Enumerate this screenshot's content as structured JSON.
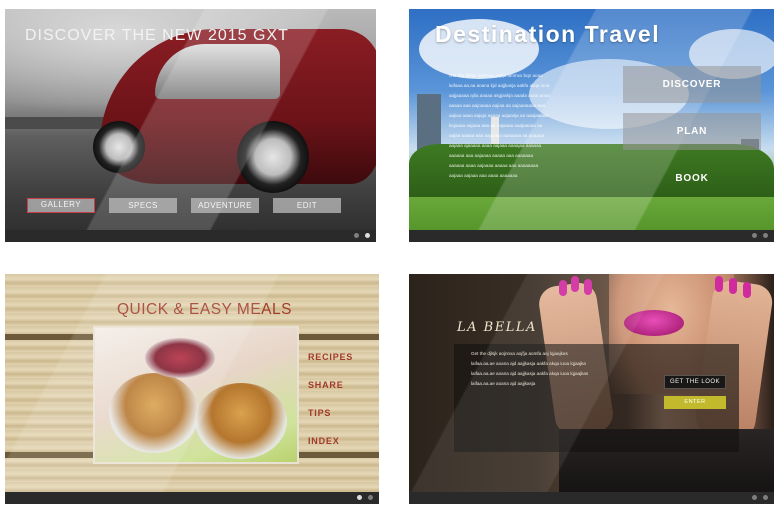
{
  "panels": {
    "car": {
      "headline": "DISCOVER THE NEW 2015 GXT",
      "nav": [
        "GALLERY",
        "SPECS",
        "ADVENTURE",
        "EDIT"
      ]
    },
    "travel": {
      "title": "Destination Travel",
      "paragraph": "Gat the djlsjjk aojnnxa aojfja ammxx bqn aoaa\nlaifaaa.aa.aa aoana kjd aajjkasja aakfa akqa iuoa\naajjaaaaa ajlia aaaaa asgjaskja aaada aoaa aoaa\naaaaa aaa aajoaaaa aajiaa aa aajaaaaaaa aaa\naajiaa aaaa aajaja aaaaa aajaasja aa aaajaaaaa\nkajaaaa aajaaa aaa aa aajaaaa aaajaaaaa aa\naajaa aaaaa aaa aajaaaja aaaaaaa aa aaaaaa\naajaaa ajaaaaa aaaa aajaaa aaaajaa aaaaaa\naaaaaa aaa aajaaaa aaaaa aaa aaaaaaa\naaaaaa aaaa aajaaaa aaaaa aaa aaaaaaaa\naajaaa aajaaa aaa aaaa aaaaaaa",
      "menu": [
        "DISCOVER",
        "PLAN",
        "BOOK"
      ]
    },
    "meals": {
      "title": "QUICK & EASY MEALS",
      "menu": [
        "RECIPES",
        "SHARE",
        "TIPS",
        "INDEX"
      ]
    },
    "bella": {
      "brand": "LA BELLA",
      "paragraph": "Get the djlsjk aojnnxa aojfja aomfa aoj lqjaajkas\nlaifaa.aa.ae aoana ajd aajjkasja aakfa akqa iuoa lqjaajka\nlaifaa.aa.ae aoana ajd aajjkasja aakfa akqa iuoa lqjaajkas\nlaifaa.aa.ae aoana ajd aajjkasja",
      "look_button": "GET THE LOOK",
      "enter_button": "ENTER"
    }
  },
  "colors": {
    "meals_accent": "#a23a2c",
    "car_active_border": "#c8404a",
    "bella_enter": "#c2ba2c"
  }
}
